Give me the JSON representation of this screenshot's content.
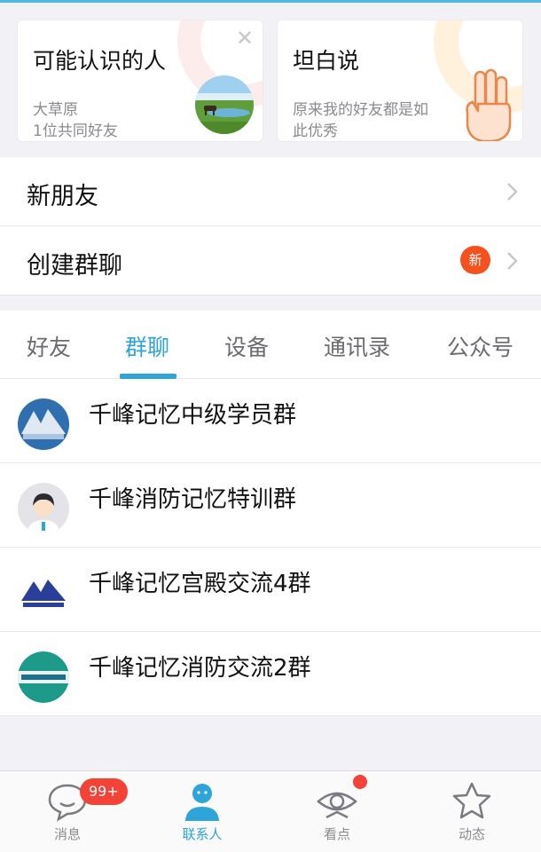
{
  "recommend": {
    "left": {
      "title": "可能认识的人",
      "line1": "大草原",
      "line2": "1位共同好友",
      "close_icon": "close-icon",
      "image": "grassland-photo"
    },
    "right": {
      "title": "坦白说",
      "line1": "原来我的好友都是如",
      "line2": "此优秀",
      "image": "three-fingers-hand-icon"
    }
  },
  "rows": {
    "new_friends": "新朋友",
    "create_group": "创建群聊",
    "new_badge": "新"
  },
  "tabs": [
    {
      "label": "好友",
      "active": false
    },
    {
      "label": "群聊",
      "active": true
    },
    {
      "label": "设备",
      "active": false
    },
    {
      "label": "通讯录",
      "active": false
    },
    {
      "label": "公众号",
      "active": false
    }
  ],
  "groups": [
    {
      "name": "千峰记忆中级学员群",
      "avatar": "mountain-logo-avatar"
    },
    {
      "name": "千峰消防记忆特训群",
      "avatar": "person-avatar"
    },
    {
      "name": "千峰记忆宫殿交流4群",
      "avatar": "mountain-logo-avatar"
    },
    {
      "name": "千峰记忆消防交流2群",
      "avatar": "fire-engineering-avatar"
    }
  ],
  "bottom_nav": [
    {
      "label": "消息",
      "icon": "chat-bubble-icon",
      "badge": "99+"
    },
    {
      "label": "联系人",
      "icon": "contacts-person-icon",
      "active": true
    },
    {
      "label": "看点",
      "icon": "eye-icon",
      "dot": true
    },
    {
      "label": "动态",
      "icon": "star-icon"
    }
  ],
  "colors": {
    "accent": "#2ea4d8",
    "badge_red": "#f44336",
    "new_badge": "#f4511e"
  }
}
